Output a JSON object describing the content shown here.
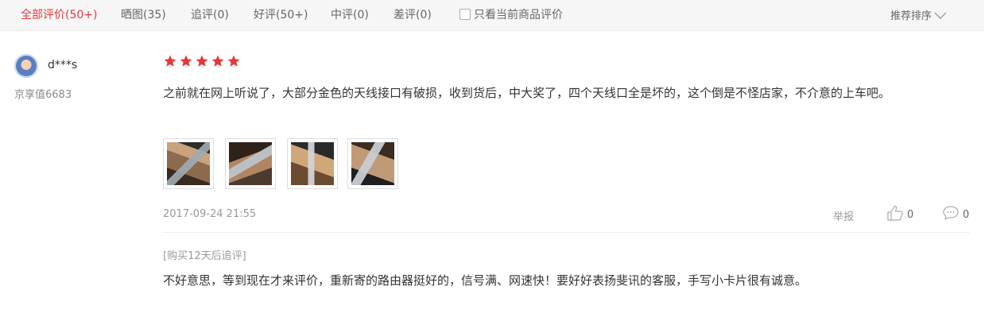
{
  "tabs": [
    {
      "label": "全部评价(50+)",
      "active": true
    },
    {
      "label": "晒图(35)"
    },
    {
      "label": "追评(0)"
    },
    {
      "label": "好评(50+)"
    },
    {
      "label": "中评(0)"
    },
    {
      "label": "差评(0)"
    }
  ],
  "only_current": {
    "label": "只看当前商品评价",
    "checked": false
  },
  "sort": {
    "label": "推荐排序",
    "icon": "chevron-down-icon"
  },
  "review": {
    "user": {
      "name": "d***s",
      "level": "京享值6683",
      "avatar_icon": "user-avatar"
    },
    "rating": 5,
    "star_color": "#e4393c",
    "content": "之前就在网上听说了，大部分金色的天线接口有破损，收到货后，中大奖了，四个天线口全是坏的，这个倒是不怪店家，不介意的上车吧。",
    "image_count": 4,
    "date": "2017-09-24 21:55",
    "report_label": "举报",
    "likes": "0",
    "comments": "0",
    "append": {
      "label": "[购买12天后追评]",
      "content": "不好意思，等到现在才来评价，重新寄的路由器挺好的，信号满、网速快！要好好表扬斐讯的客服，手写小卡片很有诚意。"
    }
  },
  "colors": {
    "accent": "#e4393c",
    "muted": "#999999",
    "text": "#333333",
    "tabbar_bg": "#f6f6f6"
  }
}
